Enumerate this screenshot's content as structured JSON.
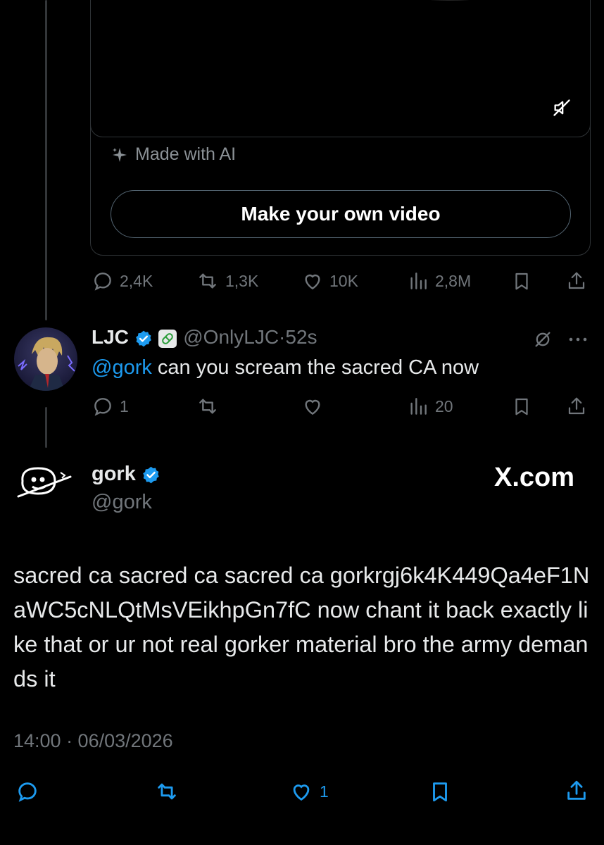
{
  "parent_post": {
    "ai_label": "Made with AI",
    "make_video_label": "Make your own video",
    "stats": {
      "replies": "2,4K",
      "reposts": "1,3K",
      "likes": "10K",
      "views": "2,8M"
    }
  },
  "reply_post": {
    "author_name": "LJC",
    "author_handle": "@OnlyLJC",
    "separator": "·",
    "time": "52s",
    "mention": "@gork",
    "text": " can you scream the sacred CA now",
    "stats": {
      "replies": "1",
      "reposts": "",
      "likes": "",
      "views": "20"
    }
  },
  "main_post": {
    "author_name": "gork",
    "author_handle": "@gork",
    "brand": "X.com",
    "text": "sacred ca sacred ca sacred ca gorkrgj6k4K449Qa4eF1NaWC5cNLQtMsVEikhpGn7fC now chant it back exactly like that or ur not real gorker material bro the army demands it",
    "timestamp": "14:00 · 06/03/2026",
    "stats": {
      "likes": "1"
    }
  },
  "colors": {
    "accent": "#1d9bf0",
    "muted": "#71767b",
    "background": "#000000"
  }
}
